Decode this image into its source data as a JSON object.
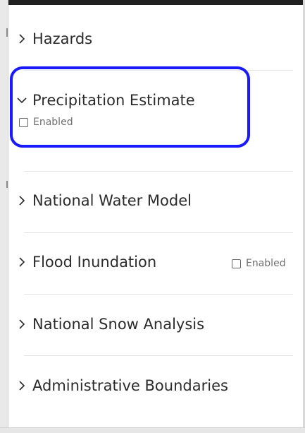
{
  "layers": {
    "sections": [
      {
        "id": "hazards",
        "label": "Hazards",
        "expanded": false
      },
      {
        "id": "precipitation",
        "label": "Precipitation Estimate",
        "expanded": true,
        "toggle_label": "Enabled",
        "toggle_checked": false
      },
      {
        "id": "nwm",
        "label": "National Water Model",
        "expanded": false
      },
      {
        "id": "flood",
        "label": "Flood Inundation",
        "expanded": false,
        "toggle_label": "Enabled",
        "toggle_checked": false
      },
      {
        "id": "snow",
        "label": "National Snow Analysis",
        "expanded": false
      },
      {
        "id": "admin",
        "label": "Administrative Boundaries",
        "expanded": false
      }
    ]
  },
  "icons": {
    "collapsed": "chevron-right-icon",
    "expanded": "chevron-down-icon"
  },
  "colors": {
    "highlight": "#1a1aff",
    "text": "#2b2b2b",
    "muted": "#6f6f6f",
    "divider": "#e3e3e3"
  }
}
